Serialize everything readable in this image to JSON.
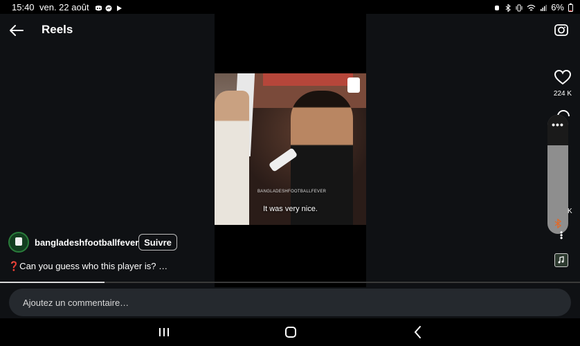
{
  "status_bar": {
    "time": "15:40",
    "date": "ven. 22 août",
    "battery": "6%",
    "notification_icons": [
      "discord-icon",
      "messenger-icon",
      "play-icon"
    ],
    "system_icons": [
      "alarm-icon",
      "bluetooth-icon",
      "vibrate-icon",
      "wifi-icon",
      "signal-icon",
      "battery-icon"
    ]
  },
  "header": {
    "title": "Reels"
  },
  "video": {
    "subtitle": "It was very nice.",
    "watermark": "BANGLADESHFOOTBALLFEVER"
  },
  "actions": {
    "like_count": "224 K",
    "partial_count": "K"
  },
  "owner": {
    "username": "bangladeshfootballfever",
    "follow_label": "Suivre"
  },
  "caption": "❓Can you guess who this player is? …",
  "progress": 0.18,
  "comment": {
    "placeholder": "Ajoutez un commentaire…"
  },
  "colors": {
    "background": "#0f1114",
    "comment_bg": "#25292e",
    "avatar_ring": "#2a7c3b",
    "bluetooth_accent": "#e06a2a"
  }
}
